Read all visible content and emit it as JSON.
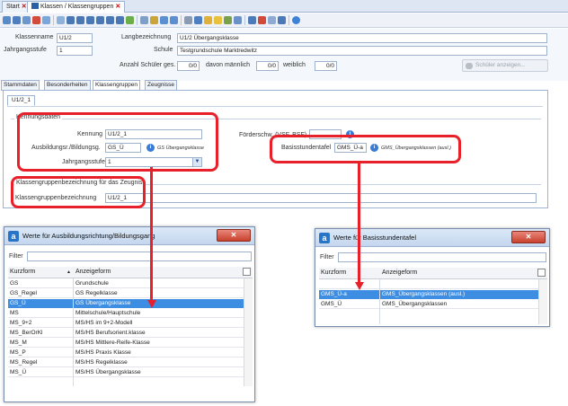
{
  "tabs": [
    {
      "label": "Start",
      "close": "✕"
    },
    {
      "label": "Klassen / Klassengruppen",
      "close": "✕"
    }
  ],
  "form": {
    "klassenname_label": "Klassenname",
    "klassenname_value": "U1/2",
    "langbezeichnung_label": "Langbezeichnung",
    "langbezeichnung_value": "U1/2 Übergangsklasse",
    "jahrgangsstufe_label": "Jahrgangsstufe",
    "jahrgangsstufe_value": "1",
    "schule_label": "Schule",
    "schule_value": "Testgrundschule Marktredwitz",
    "anzahl_label": "Anzahl Schüler ges.",
    "anzahl_value": "0/0",
    "maennlich_label": "davon männlich",
    "maennlich_value": "0/0",
    "weiblich_label": "weiblich",
    "weiblich_value": "0/0",
    "schueler_button": "Schüler anzeigen..."
  },
  "subtabs": [
    "Stammdaten",
    "Besonderheiten",
    "Klassengruppen",
    "Zeugnisse"
  ],
  "group_tab": "U1/2_1",
  "kennungsdaten": {
    "title": "Kennungsdaten",
    "kennung_label": "Kennung",
    "kennung_value": "U1/2_1",
    "ausbildung_label": "Ausbildungsr./Bildungsg.",
    "ausbildung_value": "GS_Ü",
    "ausbildung_hint": "GS Übergangsklasse",
    "jahrgangsstufe_label": "Jahrgangsstufe",
    "jahrgangsstufe_value": "1",
    "foerderschwerpunkt_label": "Förderschw. (VSF, BSF)",
    "basisstundentafel_label": "Basisstundentafel",
    "basisstundentafel_value": "GMS_Ü-a",
    "basisstundentafel_hint": "GMS_Übergangsklassen (ausl.)"
  },
  "zeugnis": {
    "title": "Klassengruppenbezeichnung für das Zeugnis",
    "label": "Klassengruppenbezeichnung",
    "value": "U1/2_1"
  },
  "dialog_left": {
    "title": "Werte für Ausbildungsrichtung/Bildungsgang",
    "close": "✕",
    "filter_label": "Filter",
    "col1": "Kurzform",
    "col1_sort": "▲",
    "col2": "Anzeigeform",
    "rows": [
      {
        "kurz": "GS",
        "anzeige": "Grundschule",
        "selected": false
      },
      {
        "kurz": "GS_Regel",
        "anzeige": "GS Regelklasse",
        "selected": false
      },
      {
        "kurz": "GS_Ü",
        "anzeige": "GS Übergangsklasse",
        "selected": true
      },
      {
        "kurz": "MS",
        "anzeige": "Mittelschule/Hauptschule",
        "selected": false
      },
      {
        "kurz": "MS_9+2",
        "anzeige": "MS/HS im 9+2-Modell",
        "selected": false
      },
      {
        "kurz": "MS_BerOrKl",
        "anzeige": "MS/HS Berufsorient.klasse",
        "selected": false
      },
      {
        "kurz": "MS_M",
        "anzeige": "MS/HS Mittlere-Reife-Klasse",
        "selected": false
      },
      {
        "kurz": "MS_P",
        "anzeige": "MS/HS Praxis Klasse",
        "selected": false
      },
      {
        "kurz": "MS_Regel",
        "anzeige": "MS/HS Regelklasse",
        "selected": false
      },
      {
        "kurz": "MS_Ü",
        "anzeige": "MS/HS Übergangsklasse",
        "selected": false
      }
    ]
  },
  "dialog_right": {
    "title": "Werte für Basisstundentafel",
    "close": "✕",
    "filter_label": "Filter",
    "col1": "Kurzform",
    "col2": "Anzeigeform",
    "rows": [
      {
        "kurz": "GMS_Ü-a",
        "anzeige": "GMS_Übergangsklassen (ausl.)",
        "selected": true
      },
      {
        "kurz": "GMS_Ü",
        "anzeige": "GMS_Übergangsklassen",
        "selected": false
      }
    ]
  },
  "colors": {
    "accent_red": "#e8202a",
    "selection_blue": "#3d8ee3"
  }
}
